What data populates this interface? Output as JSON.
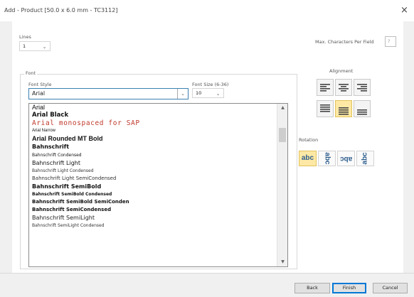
{
  "window": {
    "title": "Add - Product [50.0 x 6.0 mm - TC3112]",
    "close_label": "×"
  },
  "lines": {
    "label": "Lines",
    "value": "1"
  },
  "max_chars": {
    "label": "Max. Characters Per Field",
    "value": "?"
  },
  "font_group": {
    "label": "Font"
  },
  "font_style": {
    "label": "Font Style",
    "value": "Arial"
  },
  "font_size": {
    "label": "Font Size (6-36)",
    "value": "10"
  },
  "font_list": [
    {
      "name": "Arial",
      "family": "Liberation Sans, sans-serif",
      "size": "9px",
      "weight": "normal",
      "color": "#111111",
      "style": "normal",
      "spacing": "0"
    },
    {
      "name": "Arial Black",
      "family": "DejaVu Sans, sans-serif",
      "size": "8.5px",
      "weight": "bold",
      "color": "#111111",
      "style": "normal",
      "spacing": "0"
    },
    {
      "name": "Arial monospaced for SAP",
      "family": "DejaVu Sans Mono, monospace",
      "size": "9.5px",
      "weight": "normal",
      "color": "#c0392b",
      "style": "normal",
      "spacing": "0.6px"
    },
    {
      "name": "Arial Narrow",
      "family": "Liberation Sans, sans-serif",
      "size": "6px",
      "weight": "normal",
      "color": "#111111",
      "style": "normal",
      "spacing": "0"
    },
    {
      "name": "Arial Rounded MT Bold",
      "family": "Liberation Sans, sans-serif",
      "size": "9px",
      "weight": "bold",
      "color": "#111111",
      "style": "normal",
      "spacing": "0"
    },
    {
      "name": "Bahnschrift",
      "family": "DejaVu Sans, sans-serif",
      "size": "8px",
      "weight": "bold",
      "color": "#111111",
      "style": "normal",
      "spacing": "0"
    },
    {
      "name": "Bahnschrift Condensed",
      "family": "DejaVu Sans, sans-serif",
      "size": "6px",
      "weight": "normal",
      "color": "#111111",
      "style": "normal",
      "spacing": "0"
    },
    {
      "name": "Bahnschrift Light",
      "family": "DejaVu Sans, sans-serif",
      "size": "8px",
      "weight": "normal",
      "color": "#111111",
      "style": "normal",
      "spacing": "0"
    },
    {
      "name": "Bahnschrift Light Condensed",
      "family": "DejaVu Sans, sans-serif",
      "size": "6px",
      "weight": "normal",
      "color": "#333333",
      "style": "normal",
      "spacing": "0"
    },
    {
      "name": "Bahnschrift Light SemiCondensed",
      "family": "DejaVu Sans, sans-serif",
      "size": "7px",
      "weight": "normal",
      "color": "#333333",
      "style": "normal",
      "spacing": "0"
    },
    {
      "name": "Bahnschrift SemiBold",
      "family": "DejaVu Sans, sans-serif",
      "size": "8px",
      "weight": "bold",
      "color": "#111111",
      "style": "normal",
      "spacing": "0"
    },
    {
      "name": "Bahnschrift SemiBold Condensed",
      "family": "DejaVu Sans, sans-serif",
      "size": "6px",
      "weight": "bold",
      "color": "#111111",
      "style": "normal",
      "spacing": "0"
    },
    {
      "name": "Bahnschrift SemiBold SemiConden",
      "family": "DejaVu Sans, sans-serif",
      "size": "7px",
      "weight": "bold",
      "color": "#111111",
      "style": "normal",
      "spacing": "0"
    },
    {
      "name": "Bahnschrift SemiCondensed",
      "family": "DejaVu Sans, sans-serif",
      "size": "7px",
      "weight": "bold",
      "color": "#111111",
      "style": "normal",
      "spacing": "0"
    },
    {
      "name": "Bahnschrift SemiLight",
      "family": "DejaVu Sans, sans-serif",
      "size": "8px",
      "weight": "normal",
      "color": "#222222",
      "style": "normal",
      "spacing": "0"
    },
    {
      "name": "Bahnschrift SemiLight Condensed",
      "family": "DejaVu Sans, sans-serif",
      "size": "6px",
      "weight": "normal",
      "color": "#333333",
      "style": "normal",
      "spacing": "0"
    }
  ],
  "alignment": {
    "label": "Alignment",
    "selected_index": 4
  },
  "rotation": {
    "label": "Rotation",
    "sample_text": "abc",
    "selected_index": 0
  },
  "buttons": {
    "back": "Back",
    "finish": "Finish",
    "cancel": "Cancel"
  },
  "colors": {
    "accent": "#0078d7",
    "selection": "#fde9a5",
    "rotation_text": "#2f5f8f"
  }
}
